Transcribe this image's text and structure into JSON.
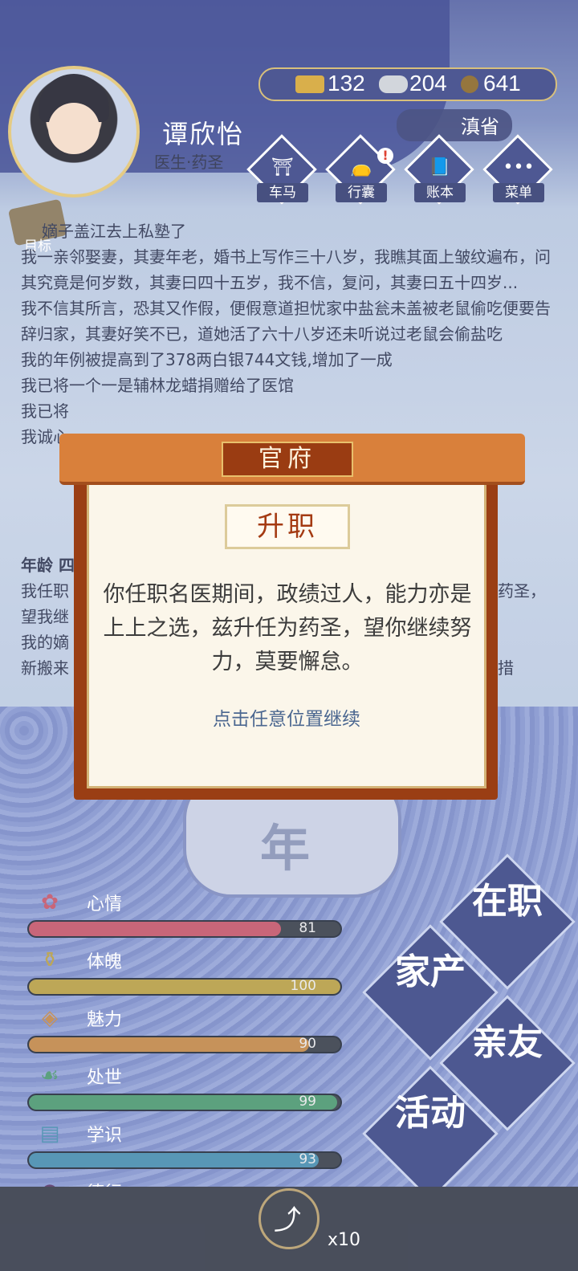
{
  "header": {
    "name": "谭欣怡",
    "title": "医生·药圣",
    "region": "滇省"
  },
  "currency": {
    "gold": "132",
    "silver": "204",
    "coin": "641"
  },
  "menu": [
    {
      "label": "车马"
    },
    {
      "label": "行囊",
      "alert": "!"
    },
    {
      "label": "账本"
    },
    {
      "label": "菜单"
    }
  ],
  "goal_label": "目标",
  "log": {
    "lines": [
      "嫡子盖江去上私塾了",
      "我一亲邻娶妻，其妻年老，婚书上写作三十八岁，我瞧其面上皱纹遍布，问其究竟是何岁数，其妻曰四十五岁，我不信，复问，其妻曰五十四岁...",
      "我不信其所言，恐其又作假，便假意道担忧家中盐瓮未盖被老鼠偷吃便要告辞归家，其妻好笑不已，道她活了六十八岁还未听说过老鼠会偷盐吃",
      "我的年例被提高到了378两白银744文钱,增加了一成",
      "我已将一个一是辅林龙蜡捐赠给了医馆",
      "我已将",
      "我诚心"
    ],
    "lower": [
      "年龄 四",
      "我任职",
      "望我继",
      "我的嫡",
      "新搬来"
    ],
    "lower_right": [
      "药圣，",
      "",
      "",
      "措"
    ]
  },
  "year_badge": "年",
  "stats": [
    {
      "label": "心情",
      "value": 81,
      "color": "#c45a6e",
      "icon": "flower-icon"
    },
    {
      "label": "体魄",
      "value": 100,
      "color": "#b8a049",
      "icon": "vase-icon"
    },
    {
      "label": "魅力",
      "value": 90,
      "color": "#c2894d",
      "icon": "mirror-icon"
    },
    {
      "label": "处世",
      "value": 99,
      "color": "#4f9a73",
      "icon": "scroll-icon"
    },
    {
      "label": "学识",
      "value": 93,
      "color": "#4a8fb0",
      "icon": "books-icon"
    },
    {
      "label": "德行",
      "value": "",
      "color": "#5b3a6b",
      "icon": "gourd-icon"
    }
  ],
  "actions": [
    "在职",
    "家产",
    "亲友",
    "活动"
  ],
  "dialog": {
    "header": "官府",
    "subtitle": "升职",
    "message": "你任职名医期间，政绩过人，能力亦是上上之选，兹升任为药圣，望你继续努力，莫要懈怠。",
    "hint": "点击任意位置继续"
  },
  "share": {
    "count": "x10"
  }
}
